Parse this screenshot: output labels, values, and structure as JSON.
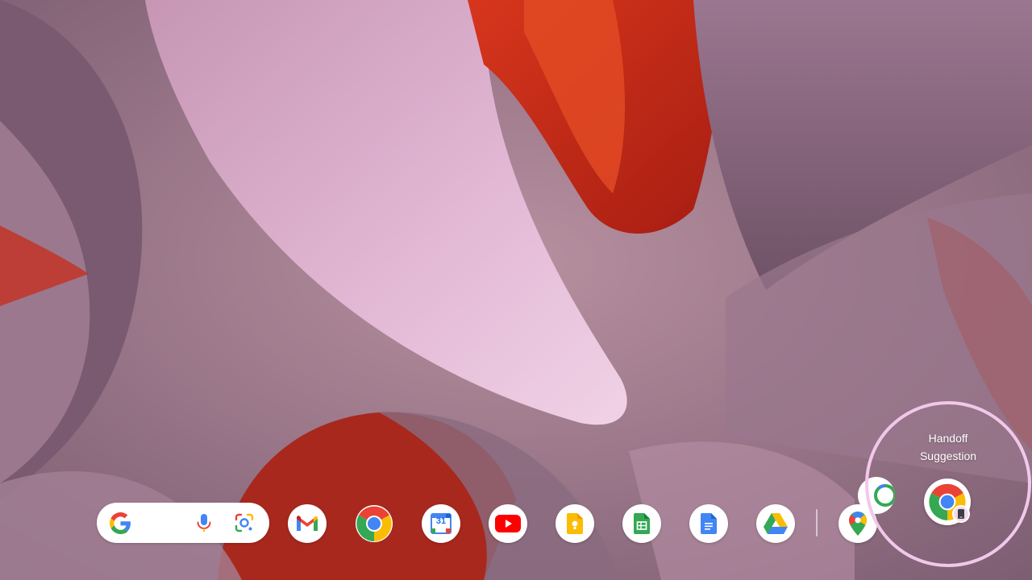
{
  "shelf": {
    "launcher": {
      "icons": [
        "google-g-icon",
        "microphone-icon",
        "lens-icon"
      ]
    },
    "apps": [
      "Gmail",
      "Chrome",
      "Calendar",
      "YouTube",
      "Keep",
      "Sheets",
      "Docs",
      "Drive",
      "Maps"
    ],
    "calendar_day": "31"
  },
  "handoff": {
    "label_line1": "Handoff",
    "label_line2": "Suggestion",
    "app": "Chrome",
    "badge_icon": "phone-icon"
  },
  "colors": {
    "google_blue": "#4285F4",
    "google_red": "#EA4335",
    "google_yellow": "#FBBC04",
    "google_green": "#34A853",
    "highlight_ring": "#F2C8EA"
  }
}
